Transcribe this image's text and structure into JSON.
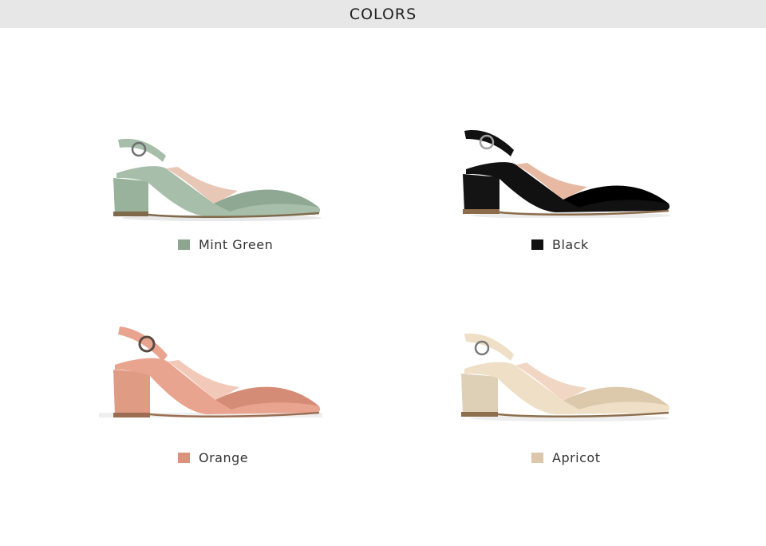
{
  "header": {
    "title": "COLORS"
  },
  "products": [
    {
      "name": "Mint Green",
      "swatch_color": "#8ea590",
      "shoe": {
        "upper": "#a7bfaa",
        "upper_dark": "#8fa893",
        "lining": "#e9c7b6",
        "heel": "#98b29b",
        "sole": "#7f6a4c",
        "buckle": "#6f6f6f"
      }
    },
    {
      "name": "Black",
      "swatch_color": "#111111",
      "shoe": {
        "upper": "#111111",
        "upper_dark": "#000000",
        "lining": "#e7b9a3",
        "heel": "#141414",
        "sole": "#8c6c4b",
        "buckle": "#a0a0a0"
      }
    },
    {
      "name": "Orange",
      "swatch_color": "#d9937d",
      "shoe": {
        "upper": "#e8a48f",
        "upper_dark": "#d58c77",
        "lining": "#f2c9b9",
        "heel": "#e09b85",
        "sole": "#9b6e52",
        "buckle": "#5a4a44"
      }
    },
    {
      "name": "Apricot",
      "swatch_color": "#dcc6ac",
      "shoe": {
        "upper": "#eedfc6",
        "upper_dark": "#dcc9ab",
        "lining": "#f1d6c4",
        "heel": "#ddd0b7",
        "sole": "#8d6f4d",
        "buckle": "#7a7a7a"
      }
    }
  ]
}
